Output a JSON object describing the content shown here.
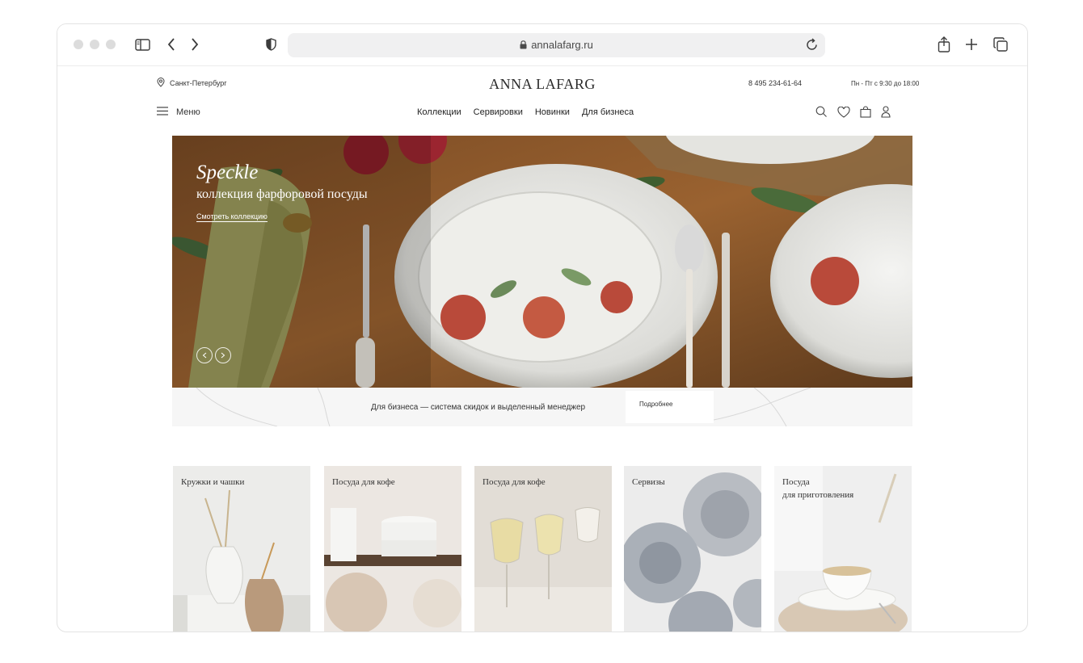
{
  "browser": {
    "url": "annalafarg.ru",
    "icons": [
      "sidebar-icon",
      "back-icon",
      "forward-icon",
      "shield-icon",
      "lock-icon",
      "reload-icon",
      "share-icon",
      "new-tab-icon",
      "tabs-icon"
    ]
  },
  "header": {
    "city": "Санкт-Петербург",
    "logo": "ANNA LAFARG",
    "phone": "8 495 234-61-64",
    "hours": "Пн - Пт с 9:30 до 18:00",
    "menu_label": "Меню",
    "nav": [
      "Коллекции",
      "Сервировки",
      "Новинки",
      "Для бизнеса"
    ],
    "icons": [
      "search-icon",
      "heart-icon",
      "bag-icon",
      "user-icon"
    ]
  },
  "hero": {
    "title": "Speckle",
    "subtitle": "коллекция фарфоровой посуды",
    "link": "Смотреть коллекцию"
  },
  "business": {
    "text": "Для бизнеса — система скидок и выделенный менеджер",
    "button": "Подробнее"
  },
  "categories": [
    {
      "label": "Кружки и чашки"
    },
    {
      "label": "Посуда для кофе"
    },
    {
      "label": "Посуда для кофе"
    },
    {
      "label": "Сервизы"
    },
    {
      "label": "Посуда\nдля приготовления"
    }
  ],
  "colors": {
    "accent": "#222222",
    "hero_table": "#8a5a2e",
    "strip_bg": "#f6f6f6"
  }
}
